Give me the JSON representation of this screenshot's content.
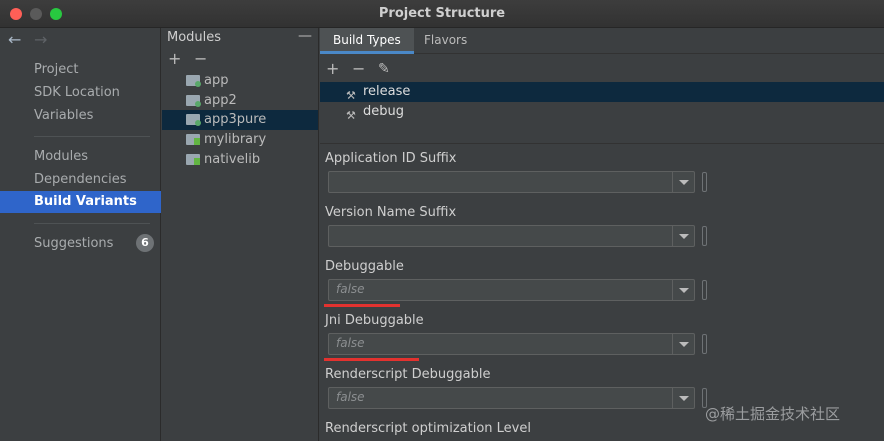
{
  "window": {
    "title": "Project Structure"
  },
  "nav": {
    "back_arrow": "←",
    "forward_arrow": "→",
    "items": [
      {
        "label": "Project"
      },
      {
        "label": "SDK Location"
      },
      {
        "label": "Variables"
      },
      {
        "label": "Modules"
      },
      {
        "label": "Dependencies"
      },
      {
        "label": "Build Variants",
        "selected": true
      },
      {
        "label": "Suggestions",
        "badge": "6"
      }
    ]
  },
  "modules": {
    "header": "Modules",
    "collapse": "—",
    "add": "+",
    "remove": "−",
    "items": [
      {
        "name": "app",
        "icon": "app-module-icon"
      },
      {
        "name": "app2",
        "icon": "app-module-icon"
      },
      {
        "name": "app3pure",
        "icon": "app-module-icon",
        "selected": true
      },
      {
        "name": "mylibrary",
        "icon": "library-module-icon"
      },
      {
        "name": "nativelib",
        "icon": "library-module-icon"
      }
    ]
  },
  "tabs": [
    {
      "label": "Build Types",
      "active": true
    },
    {
      "label": "Flavors"
    }
  ],
  "build_types": {
    "add": "+",
    "remove": "−",
    "edit": "✎",
    "items": [
      {
        "name": "release",
        "selected": true
      },
      {
        "name": "debug"
      }
    ]
  },
  "fields": [
    {
      "label": "Application ID Suffix",
      "value": ""
    },
    {
      "label": "Version Name Suffix",
      "value": ""
    },
    {
      "label": "Debuggable",
      "value": "false"
    },
    {
      "label": "Jni Debuggable",
      "value": "false"
    },
    {
      "label": "Renderscript Debuggable",
      "value": "false"
    },
    {
      "label": "Renderscript optimization Level",
      "value": ""
    }
  ],
  "watermark": "@稀土掘金技术社区",
  "colors": {
    "selection": "#2f65ca",
    "tab_indicator": "#4a88c7",
    "annotation": "#e3322f"
  }
}
